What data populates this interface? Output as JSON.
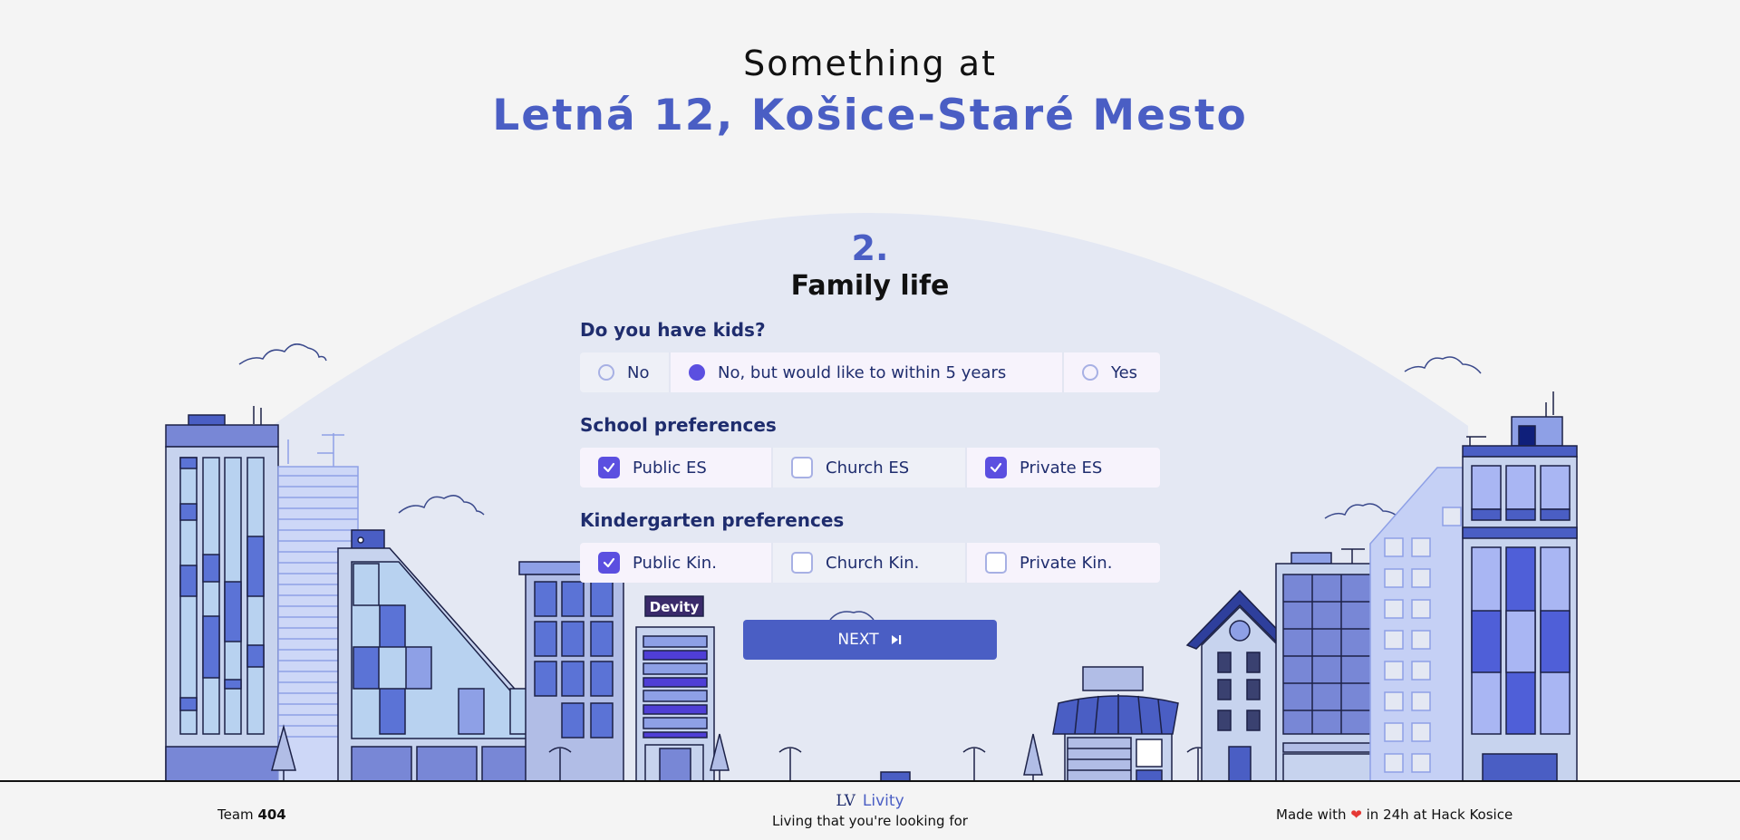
{
  "header": {
    "line1": "Something at",
    "address": "Letná 12, Košice-Staré Mesto"
  },
  "step": {
    "number": "2.",
    "title": "Family life"
  },
  "questions": {
    "kids": {
      "label": "Do you have kids?",
      "options": [
        {
          "label": "No",
          "selected": false
        },
        {
          "label": "No, but would like to within 5 years",
          "selected": true
        },
        {
          "label": "Yes",
          "selected": false
        }
      ]
    },
    "school": {
      "label": "School preferences",
      "options": [
        {
          "label": "Public ES",
          "checked": true
        },
        {
          "label": "Church ES",
          "checked": false
        },
        {
          "label": "Private ES",
          "checked": true
        }
      ]
    },
    "kindergarten": {
      "label": "Kindergarten preferences",
      "options": [
        {
          "label": "Public Kin.",
          "checked": true
        },
        {
          "label": "Church Kin.",
          "checked": false
        },
        {
          "label": "Private Kin.",
          "checked": false
        }
      ]
    }
  },
  "next_button": {
    "label": "NEXT",
    "icon": "skip-forward-icon"
  },
  "sign": "Devity",
  "footer": {
    "team_prefix": "Team",
    "team_number": "404",
    "logo_mark": "LV",
    "logo_name": "Livity",
    "tagline": "Living that you're looking for",
    "made_prefix": "Made with",
    "made_suffix": "in 24h at Hack Kosice"
  },
  "colors": {
    "accent": "#4a5ec4",
    "selected": "#5b4fe0",
    "background": "#f4f4f4",
    "dome": "#e4e8f3"
  }
}
